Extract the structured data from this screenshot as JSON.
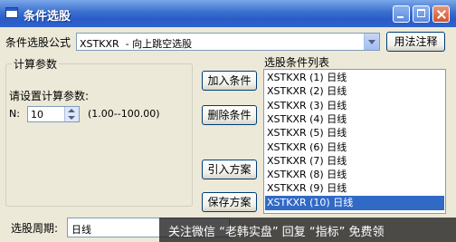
{
  "window": {
    "title": "条件选股"
  },
  "formula": {
    "label": "条件选股公式",
    "value": "XSTKXR  - 向上跳空选股",
    "usage_button": "用法注释"
  },
  "params": {
    "group_title": "计算参数",
    "prompt": "请设置计算参数:",
    "n_label": "N:",
    "n_value": "10",
    "n_range": "(1.00--100.00)"
  },
  "actions": {
    "add": "加入条件",
    "delete": "删除条件",
    "import": "引入方案",
    "save": "保存方案"
  },
  "conditions": {
    "header": "选股条件列表",
    "items": [
      "XSTKXR (1) 日线",
      "XSTKXR (2) 日线",
      "XSTKXR (3) 日线",
      "XSTKXR (4) 日线",
      "XSTKXR (5) 日线",
      "XSTKXR (6) 日线",
      "XSTKXR (7) 日线",
      "XSTKXR (8) 日线",
      "XSTKXR (9) 日线",
      "XSTKXR (10) 日线"
    ],
    "selected_index": 9
  },
  "period": {
    "label": "选股周期:",
    "value": "日线"
  },
  "watermark": {
    "text": "关注微信 “老韩实盘” 回复 “指标” 免费领"
  },
  "colors": {
    "titlebar": "#2a5cc6",
    "selection": "#316ac5",
    "dialog_bg": "#ece9d8"
  }
}
